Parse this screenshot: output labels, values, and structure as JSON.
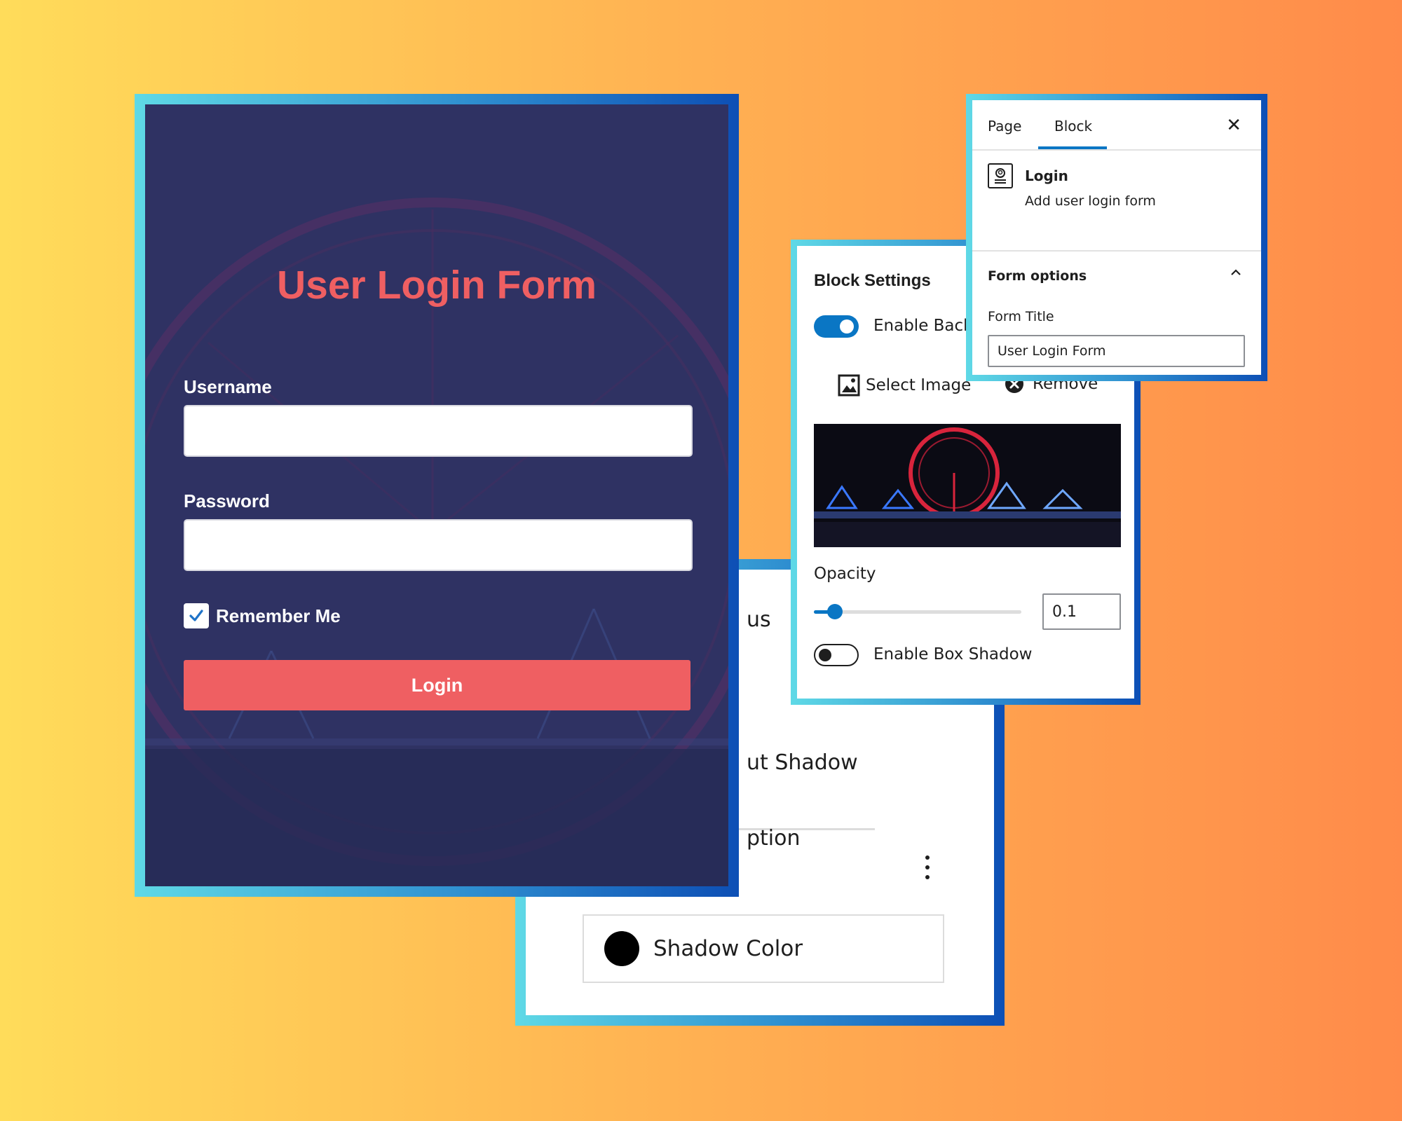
{
  "back_card": {
    "partial_label_1": "us",
    "partial_label_2": "ut Shadow",
    "partial_label_3": "ption",
    "shadow_color_label": "Shadow Color"
  },
  "login_form": {
    "title": "User Login Form",
    "username_label": "Username",
    "password_label": "Password",
    "remember_label": "Remember Me",
    "remember_checked": true,
    "login_button": "Login"
  },
  "block_settings": {
    "title": "Block Settings",
    "enable_background_label": "Enable Backg",
    "enable_background_on": true,
    "select_image_label": "Select Image",
    "remove_label": "Remove",
    "opacity_label": "Opacity",
    "opacity_value": "0.1",
    "enable_box_shadow_label": "Enable Box Shadow",
    "enable_box_shadow_on": false
  },
  "sidebar": {
    "tabs": [
      {
        "label": "Page",
        "active": false
      },
      {
        "label": "Block",
        "active": true
      }
    ],
    "close_icon": "close-icon",
    "block": {
      "name": "Login",
      "description": "Add user login form",
      "icon": "user-login-icon"
    },
    "section": {
      "title": "Form options",
      "expanded": true,
      "form_title_label": "Form Title",
      "form_title_value": "User Login Form"
    }
  },
  "colors": {
    "accent_blue": "#0a76c4",
    "login_coral": "#ef5f62",
    "form_navy": "#2f3263"
  }
}
